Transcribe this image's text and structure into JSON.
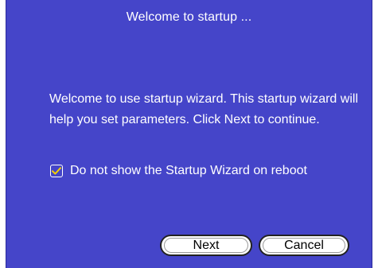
{
  "dialog": {
    "title": "Welcome to startup ...",
    "message": "Welcome to use startup wizard. This startup wizard will help you set parameters. Click Next to continue.",
    "checkbox": {
      "label": "Do not show the Startup Wizard on reboot",
      "checked": true
    },
    "buttons": {
      "next_label": "Next",
      "cancel_label": "Cancel"
    }
  },
  "colors": {
    "dialog_background": "#4545c9",
    "text": "#ffffff",
    "checkmark": "#f2d000"
  },
  "icons": {
    "checkbox": "checkmark-icon"
  }
}
